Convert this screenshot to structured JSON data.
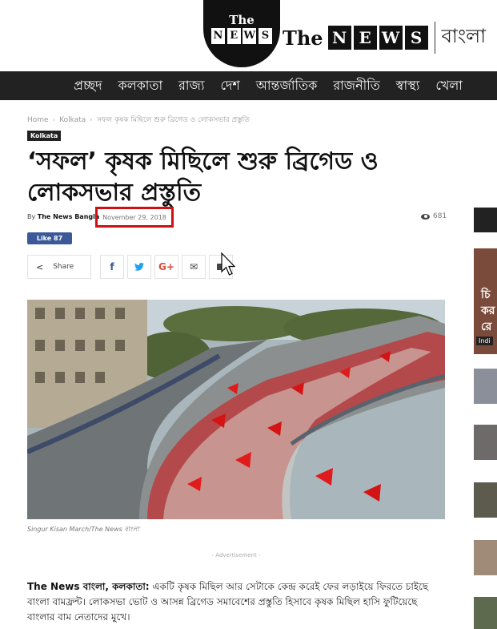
{
  "header": {
    "logo_circle_the": "The",
    "logo_circle_news": [
      "N",
      "E",
      "W",
      "S"
    ],
    "wordmark_the": "The",
    "wordmark_news": [
      "N",
      "E",
      "W",
      "S"
    ],
    "wordmark_bangla": "বাংলা"
  },
  "nav": {
    "items": [
      "প্রচ্ছদ",
      "কলকাতা",
      "রাজ্য",
      "দেশ",
      "আন্তর্জাতিক",
      "রাজনীতি",
      "স্বাস্থ্য",
      "খেলা"
    ]
  },
  "breadcrumb": {
    "home": "Home",
    "section": "Kolkata",
    "current": "সফল কৃষক মিছিলে শুরু ব্রিগেড ও লোকসভার প্রস্তুতি"
  },
  "category": "Kolkata",
  "article": {
    "title": "‘সফল’ কৃষক মিছিলে শুরু ব্রিগেড ও লোকসভার প্রস্তুতি",
    "by": "By",
    "author": "The News Bangla",
    "date": "November 29, 2018",
    "views": "681",
    "fb_like": "Like 87",
    "share_label": "Share",
    "caption": "Singur Kisan March/The News বাংলা",
    "ad_label": "- Advertisement -",
    "lead_bold": "The News বাংলা, কলকাতা:",
    "lead_text": " একটি কৃষক মিছিল আর সেটাকে কেন্দ্র করেই ফের লড়াইয়ে ফিরতে চাইছে বাংলা বামফ্রন্ট। লোকসভা ভোট ও আসন্ন ব্রিগেড সমাবেশের প্রস্তুতি হিসাবে কৃষক মিছিল হাসি ফুটিয়েছে বাংলার বাম নেতাদের মুখে।"
  },
  "share_icons": [
    "facebook-icon",
    "twitter-icon",
    "googleplus-icon",
    "mail-icon",
    "print-icon"
  ],
  "share_glyphs": {
    "facebook": "f",
    "twitter": "🐦",
    "googleplus": "G+",
    "mail": "✉"
  },
  "sidebar": {
    "feature_lines": [
      "চি",
      "কর",
      "রে"
    ],
    "feature_tag": "Indi"
  },
  "colors": {
    "nav_bg": "#222222",
    "highlight_box": "#d01010",
    "facebook": "#3b5998",
    "twitter": "#1da1f2",
    "googleplus": "#dd4b39"
  }
}
